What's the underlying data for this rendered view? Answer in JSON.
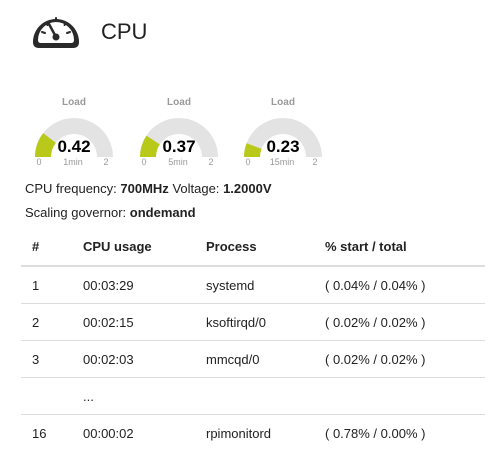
{
  "header": {
    "title": "CPU",
    "icon": "dashboard-gauge-icon"
  },
  "gauges": [
    {
      "title": "Load",
      "value": "0.42",
      "label": "1min",
      "min": "0",
      "max": "2",
      "level": 0.42,
      "range_max": 2
    },
    {
      "title": "Load",
      "value": "0.37",
      "label": "5min",
      "min": "0",
      "max": "2",
      "level": 0.37,
      "range_max": 2
    },
    {
      "title": "Load",
      "value": "0.23",
      "label": "15min",
      "min": "0",
      "max": "2",
      "level": 0.23,
      "range_max": 2
    }
  ],
  "gauge_colors": {
    "fill": "#b8c91a",
    "track": "#e3e3e3"
  },
  "info": {
    "freq_label": "CPU frequency:",
    "freq_value": "700MHz",
    "voltage_label": "Voltage:",
    "voltage_value": "1.2000V",
    "governor_label": "Scaling governor:",
    "governor_value": "ondemand"
  },
  "table": {
    "headers": [
      "#",
      "CPU usage",
      "Process",
      "% start / total"
    ],
    "rows": [
      [
        "1",
        "00:03:29",
        "systemd",
        "( 0.04% / 0.04% )"
      ],
      [
        "2",
        "00:02:15",
        "ksoftirqd/0",
        "( 0.02% / 0.02% )"
      ],
      [
        "3",
        "00:02:03",
        "mmcqd/0",
        "( 0.02% / 0.02% )"
      ],
      [
        "",
        "...",
        "",
        ""
      ],
      [
        "16",
        "00:00:02",
        "rpimonitord",
        "( 0.78% / 0.00% )"
      ]
    ]
  }
}
